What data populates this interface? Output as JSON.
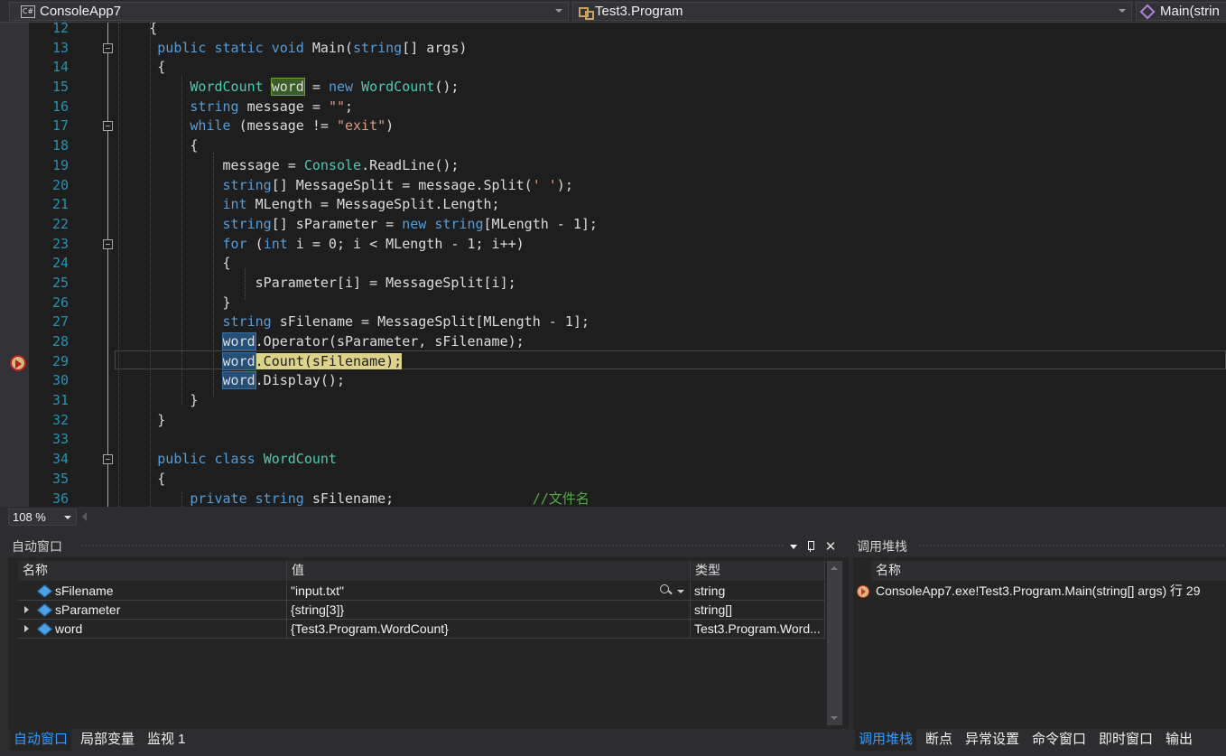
{
  "navbar": {
    "project": "ConsoleApp7",
    "project_icon": "C#",
    "type": "Test3.Program",
    "member": "Main(strin"
  },
  "editor": {
    "lines": [
      {
        "num": "12"
      },
      {
        "num": "13"
      },
      {
        "num": "14"
      },
      {
        "num": "15"
      },
      {
        "num": "16"
      },
      {
        "num": "17"
      },
      {
        "num": "18"
      },
      {
        "num": "19"
      },
      {
        "num": "20"
      },
      {
        "num": "21"
      },
      {
        "num": "22"
      },
      {
        "num": "23"
      },
      {
        "num": "24"
      },
      {
        "num": "25"
      },
      {
        "num": "26"
      },
      {
        "num": "27"
      },
      {
        "num": "28"
      },
      {
        "num": "29"
      },
      {
        "num": "30"
      },
      {
        "num": "31"
      },
      {
        "num": "32"
      },
      {
        "num": "33"
      },
      {
        "num": "34"
      },
      {
        "num": "35"
      },
      {
        "num": "36"
      }
    ],
    "zoom": "108 %"
  },
  "autos": {
    "title": "自动窗口",
    "columns": {
      "name": "名称",
      "value": "值",
      "type": "类型"
    },
    "rows": [
      {
        "name": "sFilename",
        "value": "\"input.txt\"",
        "type": "string"
      },
      {
        "name": "sParameter",
        "value": "{string[3]}",
        "type": "string[]"
      },
      {
        "name": "word",
        "value": "{Test3.Program.WordCount}",
        "type": "Test3.Program.Word..."
      }
    ],
    "tabs": [
      "自动窗口",
      "局部变量",
      "监视 1"
    ]
  },
  "callstack": {
    "title": "调用堆栈",
    "column_name": "名称",
    "frame": "ConsoleApp7.exe!Test3.Program.Main(string[] args) 行 29",
    "tabs": [
      "调用堆栈",
      "断点",
      "异常设置",
      "命令窗口",
      "即时窗口",
      "输出"
    ]
  },
  "colors": {
    "accent": "#3399ff",
    "editor_bg": "#1e1e1e",
    "keyword": "#569cd6",
    "type": "#4ec9b0",
    "string": "#d69d85",
    "comment": "#57a64a",
    "line_number": "#2b91af",
    "current_statement": "#dcd28a"
  }
}
